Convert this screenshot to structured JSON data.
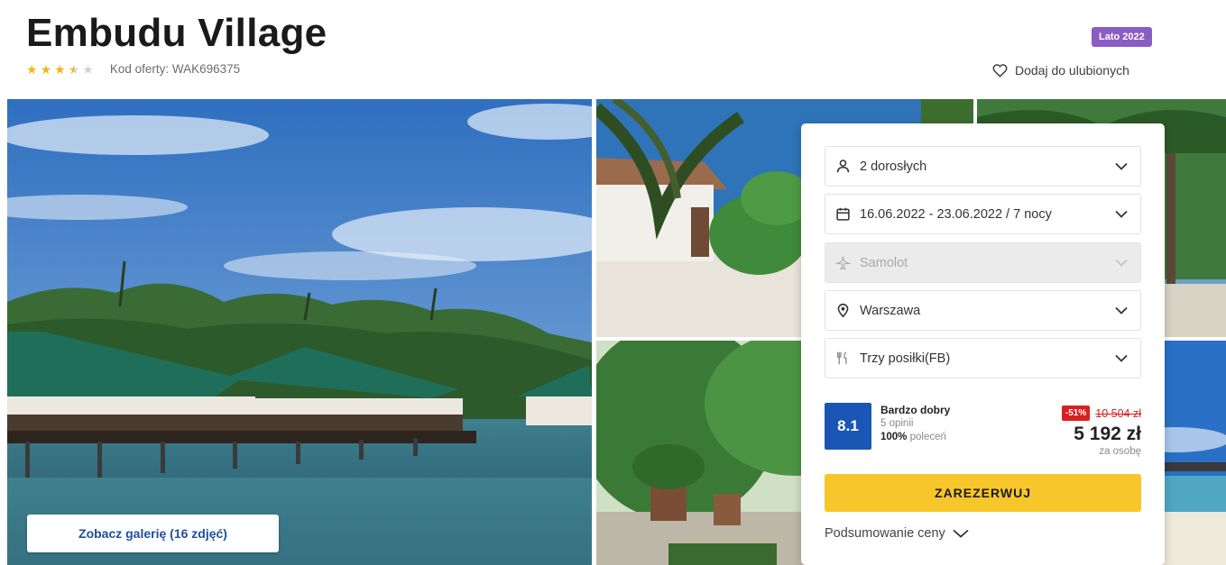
{
  "header": {
    "title": "Embudu Village",
    "rating_stars": 3.5,
    "rating_max": 5,
    "offer_code": "Kod oferty: WAK696375",
    "season_badge": "Lato 2022",
    "favorite_label": "Dodaj do ulubionych"
  },
  "gallery": {
    "button_label": "Zobacz galerię (16 zdjęć)"
  },
  "booking": {
    "fields": [
      {
        "icon": "person-icon",
        "label": "2 dorosłych",
        "disabled": false
      },
      {
        "icon": "calendar-icon",
        "label": "16.06.2022 - 23.06.2022 / 7 nocy",
        "disabled": false
      },
      {
        "icon": "plane-icon",
        "label": "Samolot",
        "disabled": true
      },
      {
        "icon": "location-pin-icon",
        "label": "Warszawa",
        "disabled": false
      },
      {
        "icon": "cutlery-icon",
        "label": "Trzy posiłki(FB)",
        "disabled": false
      }
    ],
    "rating": {
      "score": "8.1",
      "label": "Bardzo dobry",
      "reviews": "5 opinii",
      "recommend_pct": "100%",
      "recommend_label": "poleceń"
    },
    "price": {
      "discount": "-51%",
      "old_price": "10 504 zł",
      "new_price": "5 192 zł",
      "per_person": "za osobę"
    },
    "reserve_label": "ZAREZERWUJ",
    "summary_label": "Podsumowanie ceny"
  },
  "colors": {
    "brand_blue": "#1a56b4",
    "reserve_yellow": "#f6c62b",
    "discount_red": "#d82020",
    "badge_purple": "#8b5cc4",
    "star_gold": "#f3b51c"
  }
}
